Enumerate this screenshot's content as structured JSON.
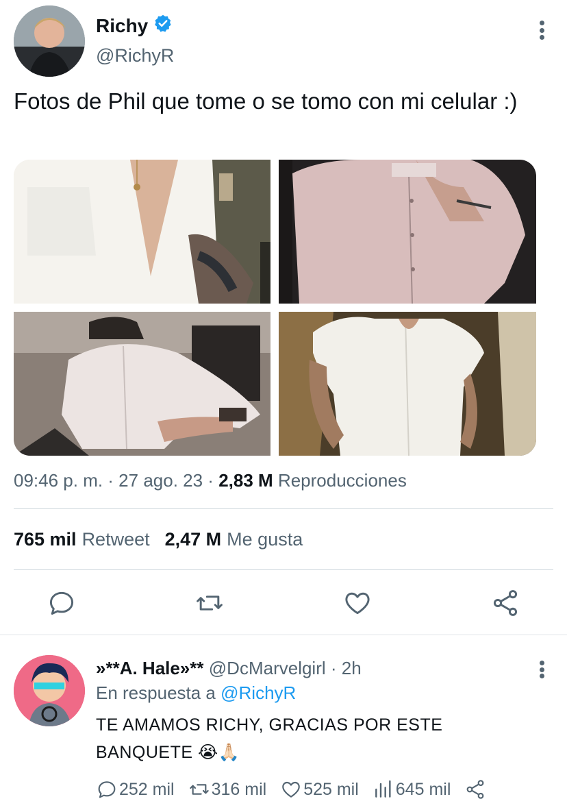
{
  "tweet": {
    "display_name": "Richy",
    "handle": "@RichyR",
    "text": "Fotos de Phil que tome o se tomo con mi celular :)",
    "time": "09:46 p. m. · 27 ago. 23 ·",
    "views_count": "2,83 M",
    "views_label": "Reproducciones",
    "retweets_count": "765 mil",
    "retweets_label": "Retweet",
    "likes_count": "2,47 M",
    "likes_label": "Me gusta",
    "icons": [
      "verified-badge-icon",
      "more-icon",
      "reply-icon",
      "retweet-icon",
      "like-icon",
      "share-icon"
    ]
  },
  "reply": {
    "name": "»**A. Hale»**",
    "handle": "@DcMarvelgirl",
    "time": "· 2h",
    "reply_to_label": "En respuesta a",
    "reply_to_handle": "@RichyR",
    "text": "TE AMAMOS RICHY, GRACIAS POR ESTE BANQUETE 😭🙏🏻",
    "replies": "252 mil",
    "retweets": "316 mil",
    "likes": "525 mil",
    "views": "645 mil"
  },
  "colors": {
    "accent": "#1d9bf0",
    "secondary_text": "#536471",
    "primary_text": "#0f1419",
    "divider": "#cfd9de"
  }
}
